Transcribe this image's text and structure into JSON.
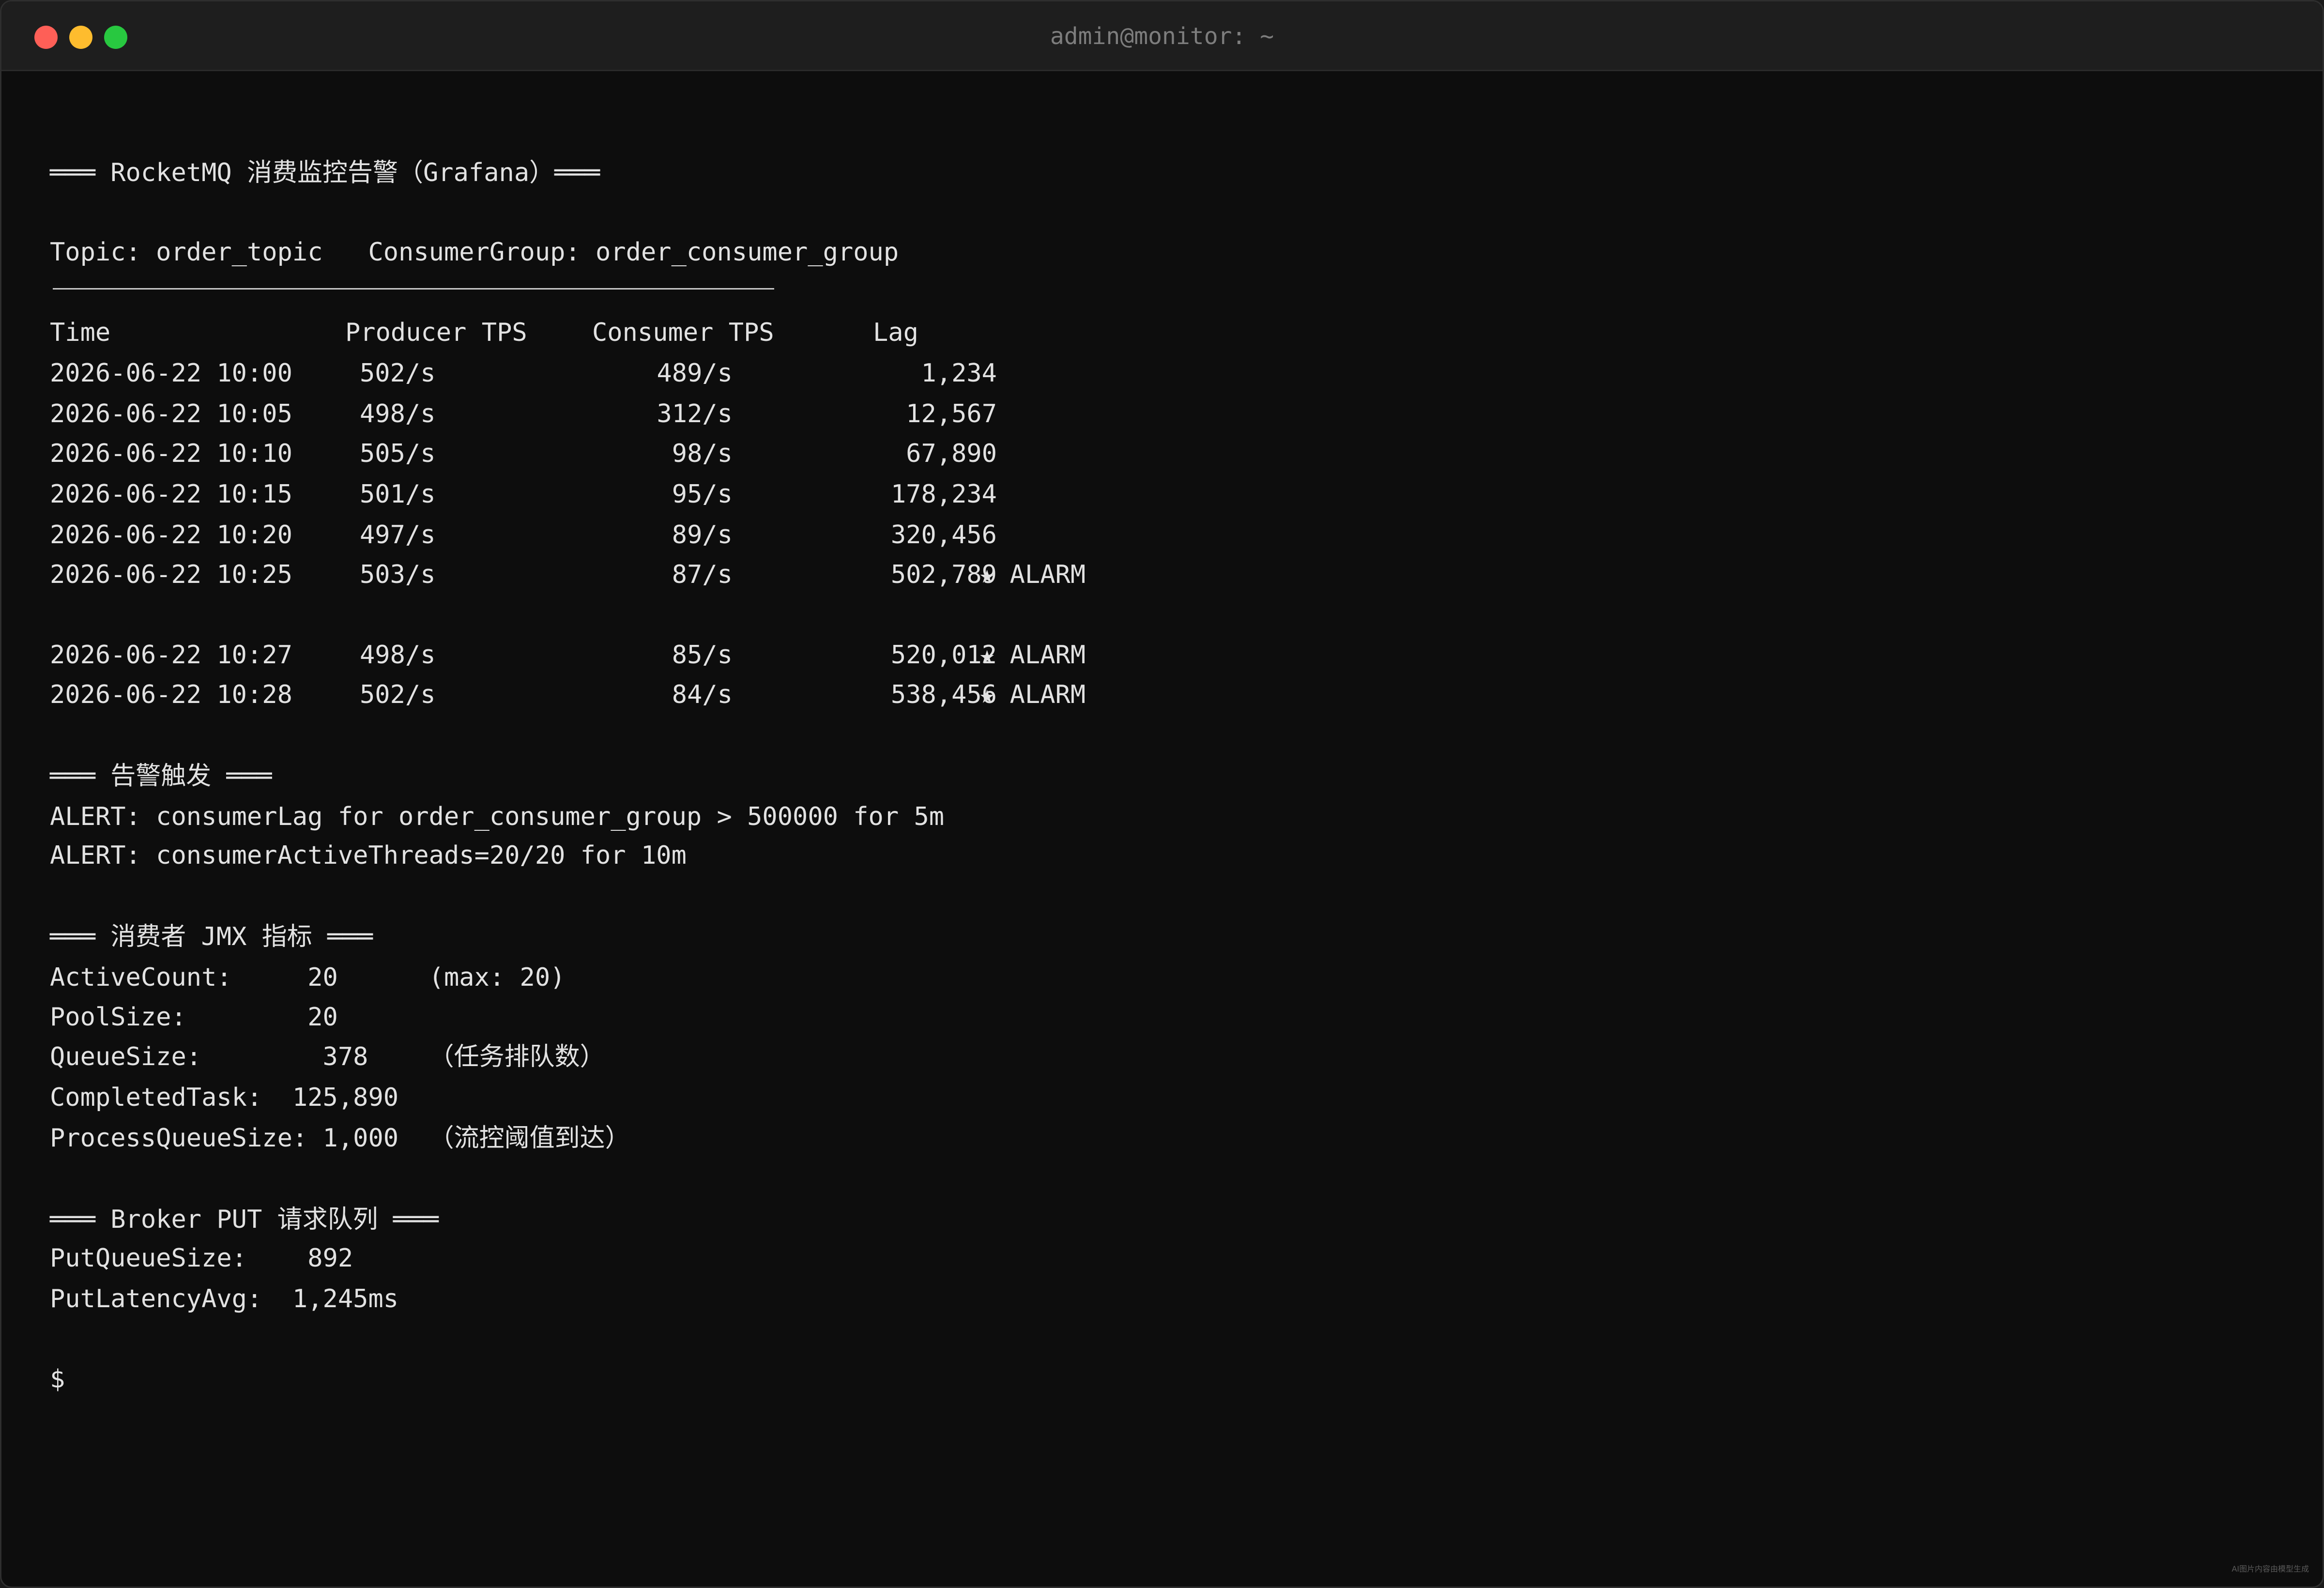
{
  "window": {
    "title": "admin@monitor: ~"
  },
  "header": {
    "title_line": "═══ RocketMQ 消费监控告警（Grafana）═══",
    "topic_line": "Topic: order_topic   ConsumerGroup: order_consumer_group"
  },
  "table": {
    "columns": [
      "Time",
      "Producer TPS",
      "Consumer TPS",
      "Lag"
    ],
    "rows": [
      {
        "time": "2026-06-22 10:00",
        "producer": "502/s",
        "consumer": "489/s",
        "lag": "1,234",
        "flag": ""
      },
      {
        "time": "2026-06-22 10:05",
        "producer": "498/s",
        "consumer": "312/s",
        "lag": "12,567",
        "flag": ""
      },
      {
        "time": "2026-06-22 10:10",
        "producer": "505/s",
        "consumer": "98/s",
        "lag": "67,890",
        "flag": ""
      },
      {
        "time": "2026-06-22 10:15",
        "producer": "501/s",
        "consumer": "95/s",
        "lag": "178,234",
        "flag": ""
      },
      {
        "time": "2026-06-22 10:20",
        "producer": "497/s",
        "consumer": "89/s",
        "lag": "320,456",
        "flag": ""
      },
      {
        "time": "2026-06-22 10:25",
        "producer": "503/s",
        "consumer": "87/s",
        "lag": "502,789",
        "flag": "★ ALARM"
      },
      {
        "time": "2026-06-22 10:27",
        "producer": "498/s",
        "consumer": "85/s",
        "lag": "520,012",
        "flag": "★ ALARM"
      },
      {
        "time": "2026-06-22 10:28",
        "producer": "502/s",
        "consumer": "84/s",
        "lag": "538,456",
        "flag": "★ ALARM"
      }
    ]
  },
  "alerts": {
    "title": "═══ 告警触发 ═══",
    "lines": [
      "ALERT: consumerLag for order_consumer_group > 500000 for 5m",
      "ALERT: consumerActiveThreads=20/20 for 10m"
    ]
  },
  "jmx": {
    "title": "═══ 消费者 JMX 指标 ═══",
    "lines": [
      "ActiveCount:     20      (max: 20)",
      "PoolSize:        20",
      "QueueSize:        378    （任务排队数）",
      "CompletedTask:  125,890",
      "ProcessQueueSize: 1,000  （流控阈值到达）"
    ]
  },
  "broker": {
    "title": "═══ Broker PUT 请求队列 ═══",
    "lines": [
      "PutQueueSize:    892",
      "PutLatencyAvg:  1,245ms"
    ]
  },
  "prompt": "$",
  "watermark": "AI图片内容由模型生成"
}
